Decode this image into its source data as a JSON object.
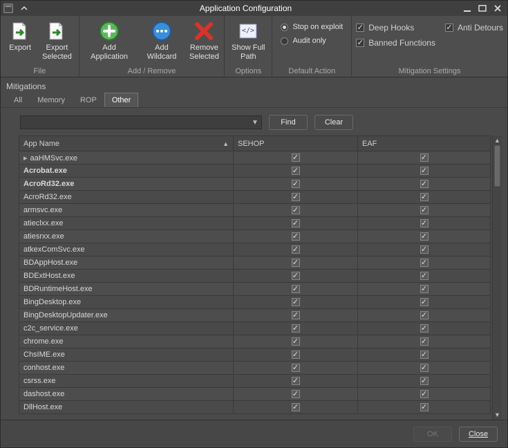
{
  "title": "Application Configuration",
  "ribbon": {
    "groups": {
      "file": {
        "label": "File",
        "export": "Export",
        "export_selected": "Export\nSelected"
      },
      "add_remove": {
        "label": "Add / Remove",
        "add_app": "Add Application",
        "add_wildcard": "Add Wildcard",
        "remove_selected": "Remove\nSelected"
      },
      "options": {
        "label": "Options",
        "show_full_path": "Show Full\nPath"
      },
      "default_action": {
        "label": "Default Action",
        "stop_on_exploit": "Stop on exploit",
        "audit_only": "Audit only"
      },
      "mitigation": {
        "label": "Mitigation Settings",
        "deep_hooks": "Deep Hooks",
        "anti_detours": "Anti Detours",
        "banned_functions": "Banned Functions"
      }
    }
  },
  "section_label": "Mitigations",
  "tabs": {
    "all": "All",
    "memory": "Memory",
    "rop": "ROP",
    "other": "Other",
    "active": "other"
  },
  "search": {
    "find": "Find",
    "clear": "Clear"
  },
  "columns": {
    "app_name": "App Name",
    "sehop": "SEHOP",
    "eaf": "EAF"
  },
  "rows": [
    {
      "name": "aaHMSvc.exe",
      "bold": false,
      "sehop": true,
      "eaf": true,
      "indicator": true
    },
    {
      "name": "Acrobat.exe",
      "bold": true,
      "sehop": true,
      "eaf": true
    },
    {
      "name": "AcroRd32.exe",
      "bold": true,
      "sehop": true,
      "eaf": true
    },
    {
      "name": "AcroRd32.exe",
      "bold": false,
      "sehop": true,
      "eaf": true
    },
    {
      "name": "armsvc.exe",
      "bold": false,
      "sehop": true,
      "eaf": true
    },
    {
      "name": "atieclxx.exe",
      "bold": false,
      "sehop": true,
      "eaf": true
    },
    {
      "name": "atiesrxx.exe",
      "bold": false,
      "sehop": true,
      "eaf": true
    },
    {
      "name": "atkexComSvc.exe",
      "bold": false,
      "sehop": true,
      "eaf": true
    },
    {
      "name": "BDAppHost.exe",
      "bold": false,
      "sehop": true,
      "eaf": true
    },
    {
      "name": "BDExtHost.exe",
      "bold": false,
      "sehop": true,
      "eaf": true
    },
    {
      "name": "BDRuntimeHost.exe",
      "bold": false,
      "sehop": true,
      "eaf": true
    },
    {
      "name": "BingDesktop.exe",
      "bold": false,
      "sehop": true,
      "eaf": true
    },
    {
      "name": "BingDesktopUpdater.exe",
      "bold": false,
      "sehop": true,
      "eaf": true
    },
    {
      "name": "c2c_service.exe",
      "bold": false,
      "sehop": true,
      "eaf": true
    },
    {
      "name": "chrome.exe",
      "bold": false,
      "sehop": true,
      "eaf": true
    },
    {
      "name": "ChsIME.exe",
      "bold": false,
      "sehop": true,
      "eaf": true
    },
    {
      "name": "conhost.exe",
      "bold": false,
      "sehop": true,
      "eaf": true
    },
    {
      "name": "csrss.exe",
      "bold": false,
      "sehop": true,
      "eaf": true
    },
    {
      "name": "dashost.exe",
      "bold": false,
      "sehop": true,
      "eaf": true
    },
    {
      "name": "DllHost.exe",
      "bold": false,
      "sehop": true,
      "eaf": true,
      "partial": true
    }
  ],
  "footer": {
    "ok": "OK",
    "close": "Close"
  }
}
